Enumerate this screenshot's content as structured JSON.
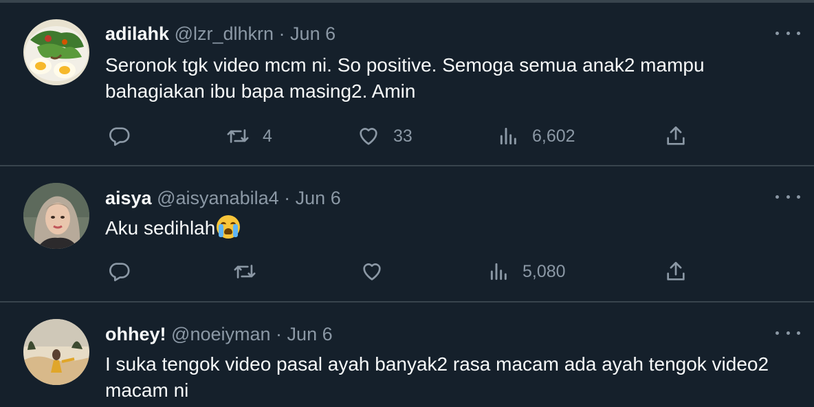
{
  "tweets": [
    {
      "name": "adilahk",
      "handle": "@lzr_dlhkrn",
      "separator": "·",
      "date": "Jun 6",
      "text": "Seronok tgk video mcm ni. So positive. Semoga semua anak2 mampu bahagiakan ibu bapa masing2. Amin",
      "retweets": "4",
      "likes": "33",
      "views": "6,602"
    },
    {
      "name": "aisya",
      "handle": "@aisyanabila4",
      "separator": "·",
      "date": "Jun 6",
      "text": "Aku sedihlah",
      "emoji": "loudly-crying-face",
      "retweets": "",
      "likes": "",
      "views": "5,080"
    },
    {
      "name": "ohhey!",
      "handle": "@noeiyman",
      "separator": "·",
      "date": "Jun 6",
      "text": "I suka tengok video pasal ayah banyak2 rasa macam ada ayah tengok video2 macam ni",
      "retweets": "",
      "likes": "",
      "views": ""
    }
  ],
  "icons": {
    "reply": "reply-icon",
    "retweet": "retweet-icon",
    "like": "heart-icon",
    "views": "views-icon",
    "share": "share-icon",
    "more": "more-options-icon"
  },
  "colors": {
    "background": "#15202b",
    "divider": "#38444d",
    "text": "#f7f9f9",
    "muted": "#8b98a5"
  }
}
